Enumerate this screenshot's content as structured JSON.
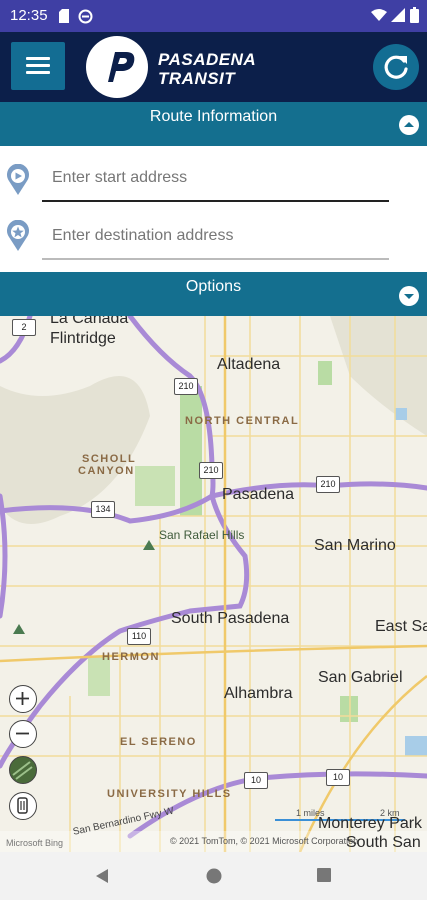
{
  "status_bar": {
    "time": "12:35"
  },
  "app_bar": {
    "logo_line1": "PASADENA",
    "logo_line2": "TRANSIT"
  },
  "route_info": {
    "title": "Route Information"
  },
  "inputs": {
    "start_placeholder": "Enter start address",
    "destination_placeholder": "Enter destination address"
  },
  "options": {
    "title": "Options"
  },
  "map": {
    "cities": {
      "la_canada": "La Cañada",
      "flintridge": "Flintridge",
      "altadena": "Altadena",
      "pasadena": "Pasadena",
      "san_marino": "San Marino",
      "south_pasadena": "South Pasadena",
      "east_sa": "East Sa",
      "alhambra": "Alhambra",
      "san_gabriel": "San Gabriel",
      "monterey_park": "Monterey Park",
      "south_san": "South San",
      "san_rafael_hills": "San Rafael Hills"
    },
    "neighborhoods": {
      "north_central": "NORTH CENTRAL",
      "scholl_1": "SCHOLL",
      "scholl_2": "CANYON",
      "hermon": "HERMON",
      "el_sereno": "EL SERENO",
      "university_hills": "UNIVERSITY HILLS"
    },
    "shields": {
      "s2": "2",
      "s210a": "210",
      "s210b": "210",
      "s210c": "210",
      "s134": "134",
      "s110": "110",
      "s10a": "10",
      "s10b": "10"
    },
    "freeway_label": "San Bernardino Fwy W",
    "scale": {
      "miles": "1 miles",
      "km": "2 km"
    },
    "attribution": "© 2021 TomTom, © 2021 Microsoft Corporation",
    "brand": "Microsoft Bing",
    "colors": {
      "freeway": "#a98ad6",
      "arterial": "#f5d98b",
      "park": "#b9dca4",
      "land": "#f3f1e8"
    }
  }
}
